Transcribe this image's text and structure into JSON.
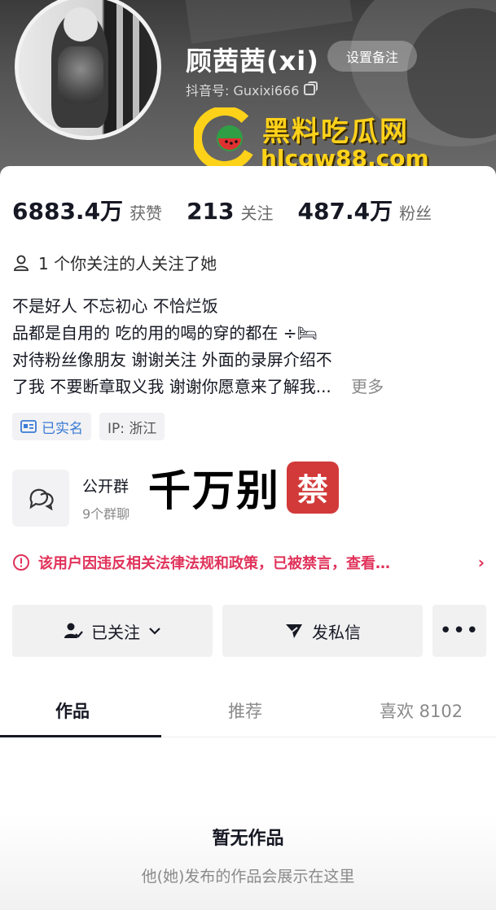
{
  "header": {
    "nickname": "顾茜茜(xi)",
    "remark_button": "设置备注",
    "douyin_id": "抖音号: Guxixi666"
  },
  "watermark": {
    "title": "黑料吃瓜网",
    "url": "hlcgw88.com"
  },
  "stats": [
    {
      "value": "6883.4万",
      "label": "获赞"
    },
    {
      "value": "213",
      "label": "关注"
    },
    {
      "value": "487.4万",
      "label": "粉丝"
    }
  ],
  "mutual_follow": "1 个你关注的人关注了她",
  "bio": {
    "line1": "不是好人 不忘初心 不恰烂饭",
    "line2": "品都是自用的 吃的用的喝的穿的都在 ÷🛏",
    "line3": " 对待粉丝像朋友 谢谢关注          外面的录屏介绍不",
    "line4": "了我 不要断章取义我 谢谢你愿意来了解我...",
    "more": "更多"
  },
  "tags": {
    "verified": "已实名",
    "ip": "IP: 浙江"
  },
  "group": {
    "title": "公开群",
    "count": "9个群聊"
  },
  "overlay": {
    "text": "千万别",
    "badge": "禁"
  },
  "notice": "该用户因违反相关法律法规和政策，已被禁言，查看…",
  "actions": {
    "follow": "已关注",
    "message": "发私信",
    "more": "•••"
  },
  "tabs": [
    {
      "label": "作品"
    },
    {
      "label": "推荐"
    },
    {
      "label": "喜欢 8102"
    }
  ],
  "empty": {
    "title": "暂无作品",
    "subtitle": "他(她)发布的作品会展示在这里"
  },
  "colors": {
    "notice_red": "#e0325a",
    "verified_blue": "#3a7bd5",
    "watermark_yellow": "#ffd21a"
  }
}
